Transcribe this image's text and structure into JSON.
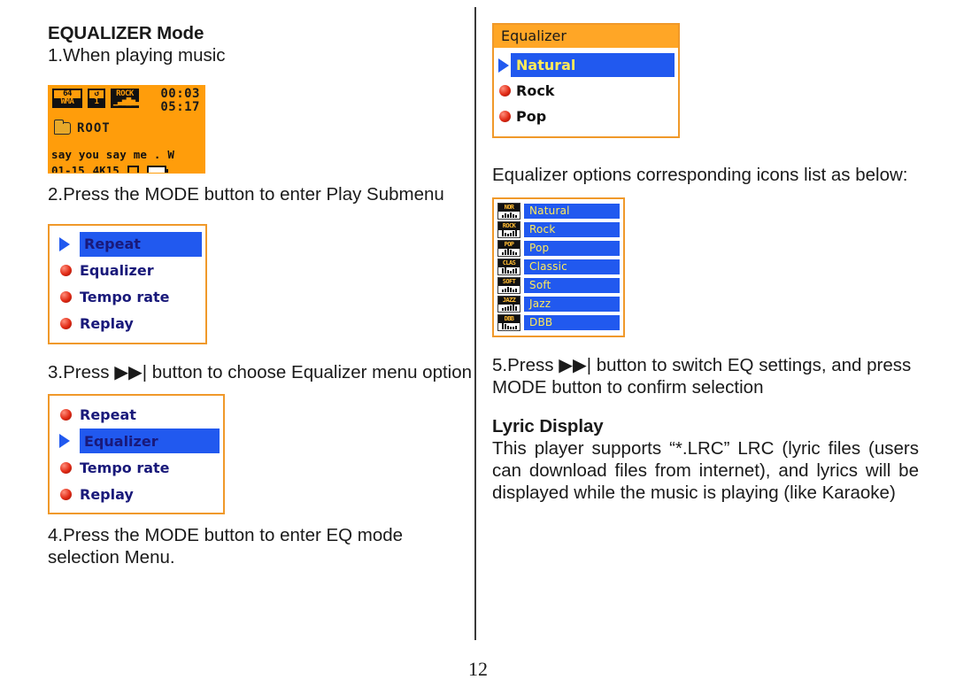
{
  "document": {
    "page_number": "12"
  },
  "left_column": {
    "heading": "EQUALIZER Mode",
    "step1": "1.When playing music",
    "step2": "2.Press the MODE button to enter Play Submenu",
    "step3": "3.Press ▶▶| button to choose Equalizer menu option",
    "step4": "4.Press the MODE button to enter EQ mode selection Menu."
  },
  "lcd_now_playing": {
    "bitrate_badge_top": "64",
    "bitrate_badge_bottom": "WMA",
    "repeat_badge_top": "↺",
    "repeat_badge_bottom": "1",
    "eq_badge_top": "ROCK",
    "elapsed_time": "00:03",
    "total_time": "05:17",
    "folder_name": "ROOT",
    "track_title": "say you say me . W",
    "track_index": "01-15",
    "volume": "4K15"
  },
  "play_submenu_1": {
    "items": [
      {
        "label": "Repeat",
        "selected": true
      },
      {
        "label": "Equalizer",
        "selected": false
      },
      {
        "label": "Tempo rate",
        "selected": false
      },
      {
        "label": "Replay",
        "selected": false
      }
    ]
  },
  "play_submenu_2": {
    "items": [
      {
        "label": "Repeat",
        "selected": false
      },
      {
        "label": "Equalizer",
        "selected": true
      },
      {
        "label": "Tempo rate",
        "selected": false
      },
      {
        "label": "Replay",
        "selected": false
      }
    ]
  },
  "right_column": {
    "equalizer_popup": {
      "title": "Equalizer",
      "items": [
        {
          "label": "Natural",
          "selected": true
        },
        {
          "label": "Rock",
          "selected": false
        },
        {
          "label": "Pop",
          "selected": false
        }
      ]
    },
    "icons_intro": "Equalizer options corresponding icons list as below:",
    "eq_legend": [
      {
        "tag": "NOR",
        "label": "Natural"
      },
      {
        "tag": "ROCK",
        "label": "Rock"
      },
      {
        "tag": "POP",
        "label": "Pop"
      },
      {
        "tag": "CLAS",
        "label": "Classic"
      },
      {
        "tag": "SOFT",
        "label": "Soft"
      },
      {
        "tag": "JAZZ",
        "label": "Jazz"
      },
      {
        "tag": "DBB",
        "label": "DBB"
      }
    ],
    "step5": "5.Press ▶▶| button to switch EQ settings, and press MODE button to confirm selection",
    "lyric_heading": "Lyric Display",
    "lyric_body": "This player supports “*.LRC” LRC (lyric files (users can download files from internet), and lyrics will be displayed while the music is playing (like Karaoke)"
  },
  "colors": {
    "lcd_background": "#ff9d0b",
    "menu_border": "#f0992a",
    "selection_blue": "#2159ef",
    "selection_text": "#ffea5a",
    "menu_text_blue": "#19197a",
    "title_bar_orange": "#ffa626"
  }
}
